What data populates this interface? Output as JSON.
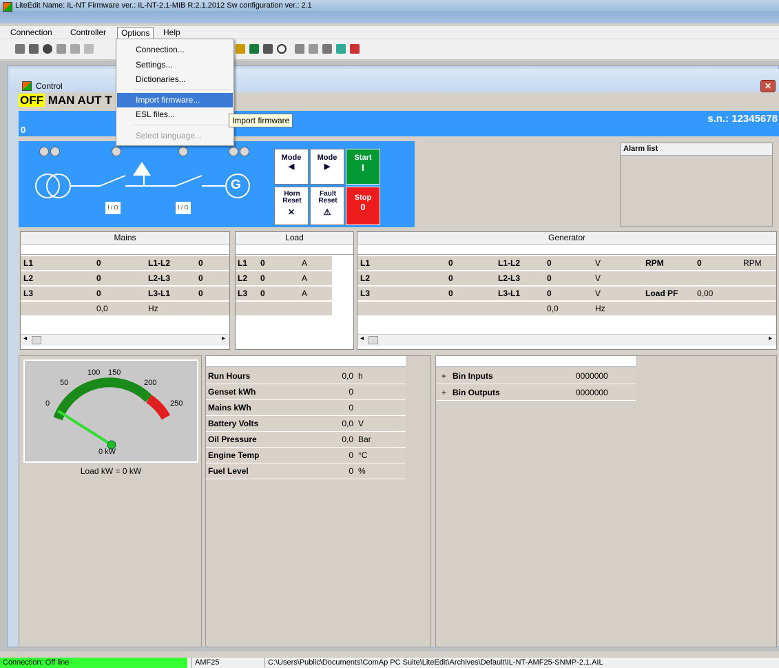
{
  "window": {
    "title": "LiteEdit Name: IL-NT Firmware ver.: IL-NT-2.1-MIB R:2.1.2012 Sw configuration ver.: 2.1"
  },
  "menubar": {
    "items": [
      "Connection",
      "Controller",
      "Options",
      "Help"
    ]
  },
  "options_menu": {
    "items": [
      "Connection...",
      "Settings...",
      "Dictionaries...",
      "Import firmware...",
      "ESL files...",
      "Select language..."
    ],
    "tooltip": "Import firmware"
  },
  "control": {
    "title": "Control",
    "modes": {
      "off": "OFF",
      "man": "MAN",
      "aut": "AUT",
      "test": "T"
    },
    "blue_value": "0",
    "serial": "s.n.: 12345678",
    "breaker_label": "I / O",
    "gen_symbol": "G",
    "buttons": {
      "mode_left": "Mode",
      "mode_right": "Mode",
      "start": "Start",
      "start_sym": "I",
      "horn": "Horn Reset",
      "fault": "Fault Reset",
      "stop": "Stop",
      "stop_sym": "0",
      "arrow_left": "◀",
      "arrow_right": "▶"
    },
    "alarm_list": "Alarm list"
  },
  "mains": {
    "title": "Mains",
    "rows": [
      [
        "L1",
        "0",
        "L1-L2",
        "0"
      ],
      [
        "L2",
        "0",
        "L2-L3",
        "0"
      ],
      [
        "L3",
        "0",
        "L3-L1",
        "0"
      ],
      [
        "",
        "0,0",
        "Hz",
        ""
      ]
    ]
  },
  "load": {
    "title": "Load",
    "rows": [
      [
        "L1",
        "0",
        "A"
      ],
      [
        "L2",
        "0",
        "A"
      ],
      [
        "L3",
        "0",
        "A"
      ]
    ]
  },
  "generator": {
    "title": "Generator",
    "rows": [
      [
        "L1",
        "0",
        "L1-L2",
        "0",
        "V",
        "RPM",
        "0",
        "RPM"
      ],
      [
        "L2",
        "0",
        "L2-L3",
        "0",
        "V",
        "",
        "",
        ""
      ],
      [
        "L3",
        "0",
        "L3-L1",
        "0",
        "V",
        "Load PF",
        "0,00",
        ""
      ],
      [
        "",
        "",
        "",
        "0,0",
        "Hz",
        "",
        "",
        ""
      ]
    ]
  },
  "gauge": {
    "ticks": [
      "0",
      "50",
      "100",
      "150",
      "200",
      "250"
    ],
    "reading": "0 kW",
    "caption": "Load kW = 0 kW",
    "value": 0,
    "min": 0,
    "max": 250
  },
  "values": {
    "rows": [
      [
        "Run Hours",
        "0,0",
        "h"
      ],
      [
        "Genset kWh",
        "0",
        ""
      ],
      [
        "Mains kWh",
        "0",
        ""
      ],
      [
        "Battery Volts",
        "0,0",
        "V"
      ],
      [
        "Oil Pressure",
        "0,0",
        "Bar"
      ],
      [
        "Engine Temp",
        "0",
        "°C"
      ],
      [
        "Fuel Level",
        "0",
        "%"
      ]
    ]
  },
  "bins": {
    "rows": [
      [
        "Bin Inputs",
        "0000000"
      ],
      [
        "Bin Outputs",
        "0000000"
      ]
    ],
    "expand": "+"
  },
  "statusbar": {
    "connection": "Connection: Off line",
    "device": "AMF25",
    "path": "C:\\Users\\Public\\Documents\\ComAp PC Suite\\LiteEdit\\Archives\\Default\\IL-NT-AMF25-SNMP-2.1.AIL"
  },
  "colors": {
    "accent_blue": "#3399ff",
    "start_green": "#009933",
    "stop_red": "#ee1c1c",
    "off_yellow": "#ffff00",
    "status_green": "#33ff33"
  }
}
